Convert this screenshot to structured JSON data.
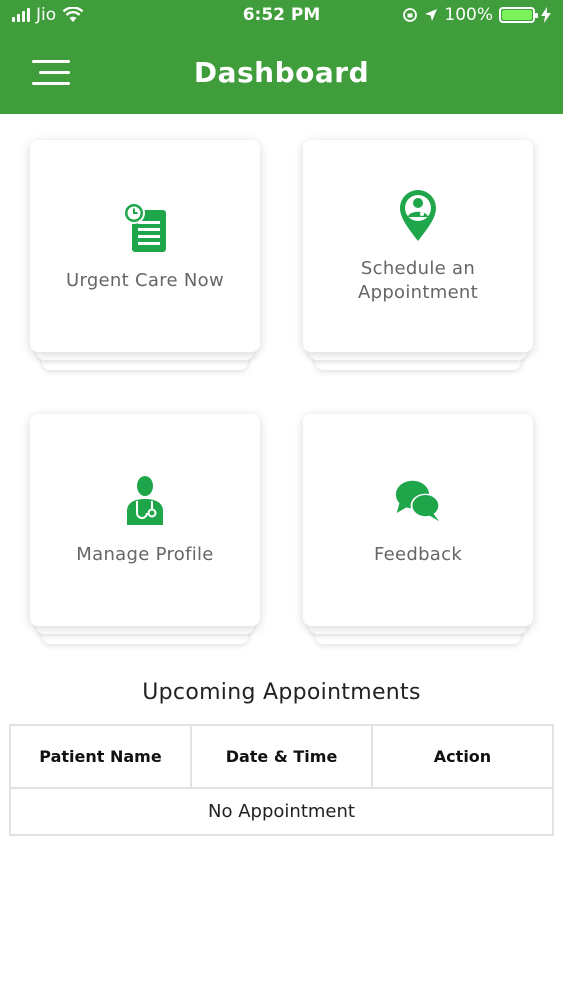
{
  "status_bar": {
    "carrier": "Jio",
    "time": "6:52 PM",
    "battery": "100%"
  },
  "header": {
    "title": "Dashboard"
  },
  "cards": [
    {
      "label": "Urgent Care Now",
      "icon": "clipboard-clock-icon"
    },
    {
      "label": "Schedule an\nAppointment",
      "icon": "doctor-location-pin-icon"
    },
    {
      "label": "Manage Profile",
      "icon": "doctor-profile-icon"
    },
    {
      "label": "Feedback",
      "icon": "chat-bubbles-icon"
    }
  ],
  "appointments": {
    "title": "Upcoming Appointments",
    "columns": [
      "Patient Name",
      "Date & Time",
      "Action"
    ],
    "empty_text": "No Appointment"
  },
  "colors": {
    "brand": "#3f9d3b",
    "icon": "#1fa54a"
  }
}
